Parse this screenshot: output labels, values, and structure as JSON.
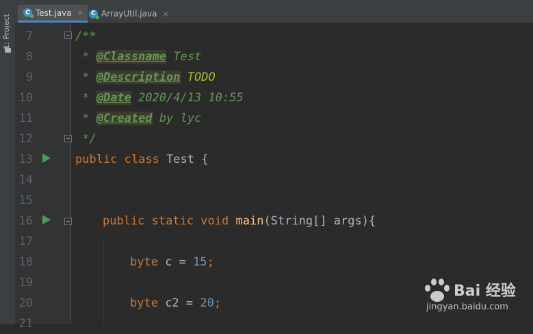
{
  "sidebar": {
    "project_label": "1: Project"
  },
  "tabs": [
    {
      "label": "Test.java",
      "icon": "c",
      "active": true,
      "close": "×"
    },
    {
      "label": "ArrayUtil.java",
      "icon": "c",
      "active": false,
      "close": "×"
    }
  ],
  "lines": [
    {
      "num": "7"
    },
    {
      "num": "8"
    },
    {
      "num": "9"
    },
    {
      "num": "10"
    },
    {
      "num": "11"
    },
    {
      "num": "12"
    },
    {
      "num": "13"
    },
    {
      "num": "14"
    },
    {
      "num": "15"
    },
    {
      "num": "16"
    },
    {
      "num": "17"
    },
    {
      "num": "18"
    },
    {
      "num": "19"
    },
    {
      "num": "20"
    },
    {
      "num": "21"
    }
  ],
  "code": {
    "l7": "/**",
    "l8_star": " * ",
    "l8_tag": "@Classname",
    "l8_rest": " Test",
    "l9_star": " * ",
    "l9_tag": "@Description",
    "l9_rest": " TODO",
    "l10_star": " * ",
    "l10_tag": "@Date",
    "l10_rest": " 2020/4/13 10:55",
    "l11_star": " * ",
    "l11_tag": "@Created",
    "l11_rest": " by lyc",
    "l12": " */",
    "l13_kw": "public class",
    "l13_name": " Test {",
    "l16_kw": "public static void",
    "l16_fn": "main",
    "l16_rest": "(String[] args){",
    "l18_kw": "byte",
    "l18_var": " c = ",
    "l18_num": "15",
    "l18_end": ";",
    "l20_kw": "byte",
    "l20_var": " c2 = ",
    "l20_num": "20",
    "l20_end": ";"
  },
  "watermark": {
    "logo": "Bai 经验",
    "url": "jingyan.baidu.com"
  },
  "colors": {
    "keyword": "#cc7832",
    "function": "#ffc66d",
    "number": "#6897bb",
    "comment": "#629755",
    "run": "#499c54"
  }
}
